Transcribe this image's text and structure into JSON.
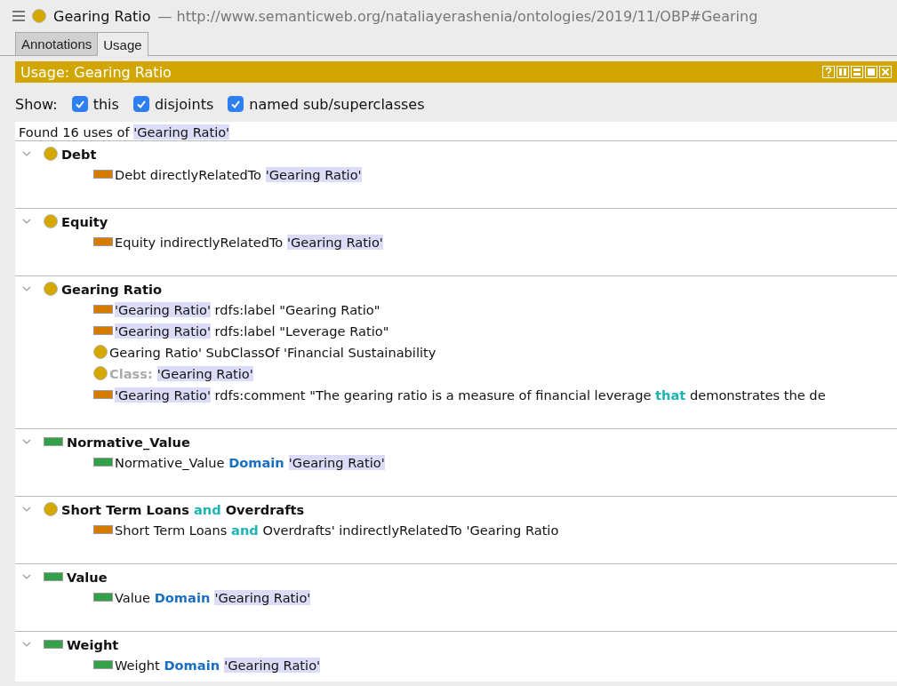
{
  "window": {
    "title": "Gearing Ratio",
    "iri": "— http://www.semanticweb.org/nataliayerashenia/ontologies/2019/11/OBP#Gearing"
  },
  "tabs": [
    {
      "label": "Annotations",
      "selected": false
    },
    {
      "label": "Usage",
      "selected": true
    }
  ],
  "panel": {
    "title": "Usage: Gearing Ratio"
  },
  "show": {
    "label": "Show:",
    "options": [
      {
        "label": "this",
        "checked": true
      },
      {
        "label": "disjoints",
        "checked": true
      },
      {
        "label": "named sub/superclasses",
        "checked": true
      }
    ]
  },
  "summary": [
    {
      "text": "Found 16 uses of ",
      "kind": "text"
    },
    {
      "text": "'Gearing Ratio'",
      "kind": "entity"
    }
  ],
  "groups": [
    {
      "kind": "class",
      "expanded": true,
      "title": [
        {
          "text": "Debt",
          "kind": "text"
        }
      ],
      "children": [
        {
          "kind": "object-property",
          "segments": [
            {
              "text": "Debt directlyRelatedTo ",
              "kind": "text"
            },
            {
              "text": "'Gearing Ratio'",
              "kind": "entity"
            }
          ]
        }
      ]
    },
    {
      "kind": "class",
      "expanded": true,
      "title": [
        {
          "text": "Equity",
          "kind": "text"
        }
      ],
      "children": [
        {
          "kind": "object-property",
          "segments": [
            {
              "text": "Equity indirectlyRelatedTo ",
              "kind": "text"
            },
            {
              "text": "'Gearing Ratio'",
              "kind": "entity"
            }
          ]
        }
      ]
    },
    {
      "kind": "class",
      "expanded": true,
      "title": [
        {
          "text": "Gearing Ratio",
          "kind": "text"
        }
      ],
      "children": [
        {
          "kind": "annotation",
          "segments": [
            {
              "text": "'Gearing Ratio'",
              "kind": "entity"
            },
            {
              "text": " rdfs:label \"Gearing Ratio\"",
              "kind": "text"
            }
          ]
        },
        {
          "kind": "annotation",
          "segments": [
            {
              "text": "'Gearing Ratio'",
              "kind": "entity"
            },
            {
              "text": " rdfs:label \"Leverage Ratio\"",
              "kind": "text"
            }
          ]
        },
        {
          "kind": "class",
          "segments": [
            {
              "text": "Gearing Ratio' SubClassOf 'Financial Sustainability",
              "kind": "text"
            }
          ]
        },
        {
          "kind": "class",
          "segments": [
            {
              "text": "Class: ",
              "kind": "frame"
            },
            {
              "text": "'Gearing Ratio'",
              "kind": "entity"
            }
          ]
        },
        {
          "kind": "annotation",
          "segments": [
            {
              "text": "'Gearing Ratio'",
              "kind": "entity"
            },
            {
              "text": " rdfs:comment \"The gearing ratio is a measure of financial leverage ",
              "kind": "text"
            },
            {
              "text": "that",
              "kind": "operator"
            },
            {
              "text": " demonstrates the de",
              "kind": "text"
            }
          ]
        }
      ]
    },
    {
      "kind": "data-property",
      "expanded": true,
      "title": [
        {
          "text": "Normative_Value",
          "kind": "text"
        }
      ],
      "children": [
        {
          "kind": "data-property",
          "segments": [
            {
              "text": "Normative_Value ",
              "kind": "text"
            },
            {
              "text": "Domain ",
              "kind": "keyword"
            },
            {
              "text": "'Gearing Ratio'",
              "kind": "entity"
            }
          ]
        }
      ]
    },
    {
      "kind": "class",
      "expanded": true,
      "title": [
        {
          "text": "Short Term Loans ",
          "kind": "text"
        },
        {
          "text": "and",
          "kind": "operator"
        },
        {
          "text": " Overdrafts",
          "kind": "text"
        }
      ],
      "children": [
        {
          "kind": "object-property",
          "segments": [
            {
              "text": "Short Term Loans ",
              "kind": "text"
            },
            {
              "text": "and",
              "kind": "operator"
            },
            {
              "text": " Overdrafts' indirectlyRelatedTo 'Gearing Ratio",
              "kind": "text"
            }
          ]
        }
      ]
    },
    {
      "kind": "data-property",
      "expanded": true,
      "title": [
        {
          "text": "Value",
          "kind": "text"
        }
      ],
      "children": [
        {
          "kind": "data-property",
          "segments": [
            {
              "text": "Value ",
              "kind": "text"
            },
            {
              "text": "Domain ",
              "kind": "keyword"
            },
            {
              "text": "'Gearing Ratio'",
              "kind": "entity"
            }
          ]
        }
      ]
    },
    {
      "kind": "data-property",
      "expanded": true,
      "title": [
        {
          "text": "Weight",
          "kind": "text"
        }
      ],
      "children": [
        {
          "kind": "data-property",
          "segments": [
            {
              "text": "Weight ",
              "kind": "text"
            },
            {
              "text": "Domain ",
              "kind": "keyword"
            },
            {
              "text": "'Gearing Ratio'",
              "kind": "entity"
            }
          ]
        }
      ]
    }
  ]
}
